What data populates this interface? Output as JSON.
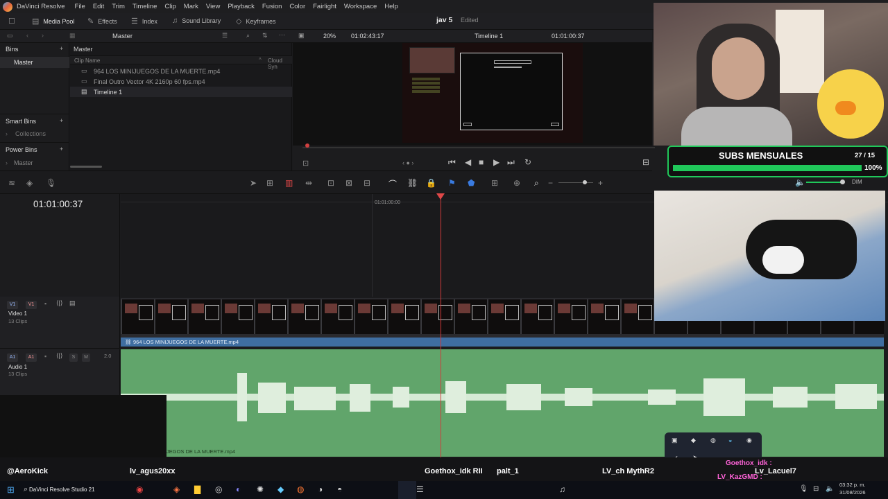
{
  "app": {
    "title": "DaVinci Resolve",
    "menu": [
      "File",
      "Edit",
      "Trim",
      "Timeline",
      "Clip",
      "Mark",
      "View",
      "Playback",
      "Fusion",
      "Color",
      "Fairlight",
      "Workspace",
      "Help"
    ]
  },
  "toolbar": {
    "media_pool": "Media Pool",
    "effects": "Effects",
    "index": "Index",
    "sound_library": "Sound Library",
    "keyframes": "Keyframes",
    "project_name": "jav 5",
    "project_status": "Edited"
  },
  "subbar": {
    "bin_name": "Master",
    "zoom": "20%",
    "source_timecode": "01:02:43:17",
    "timeline_name": "Timeline 1",
    "timeline_timecode": "01:01:00:37"
  },
  "bins": {
    "header": "Bins",
    "master": "Master",
    "smart_bins": "Smart Bins",
    "collections": "Collections",
    "power_bins": "Power Bins",
    "power_master": "Master"
  },
  "clips": {
    "breadcrumb": "Master",
    "col_name": "Clip Name",
    "col_cloud": "Cloud Syn",
    "items": [
      {
        "name": "964 LOS MINIJUEGOS DE LA MUERTE.mp4",
        "icon": "video-clip-icon"
      },
      {
        "name": "Final Outro Vector 4K 2160p 60 fps.mp4",
        "icon": "video-clip-icon"
      },
      {
        "name": "Timeline 1",
        "icon": "timeline-icon"
      }
    ]
  },
  "timeline": {
    "timecode": "01:01:00:37",
    "ruler_label": "01:01:00:00",
    "v1": {
      "badge_a": "V1",
      "badge_b": "V1",
      "name": "Video 1",
      "clips": "13 Clips",
      "clip_label": "964 LOS MINIJUEGOS DE LA MUERTE.mp4"
    },
    "a1": {
      "badge_a": "A1",
      "badge_b": "A1",
      "s": "S",
      "m": "M",
      "level": "2.0",
      "name": "Audio 1",
      "clips": "13 Clips",
      "clip_label": "JEGOS DE LA MUERTE.mp4"
    },
    "volume_label": "DIM"
  },
  "overlay": {
    "subs_title": "SUBS MENSUALES",
    "subs_count": "27 / 15",
    "subs_percent": "100%",
    "subs_progress": 1.0
  },
  "stream_bar": {
    "names": [
      "@AeroKick",
      "lv_agus20xx",
      "Goethox_idk RII",
      "palt_1",
      "LV_ch MythR2",
      "Goethox_idk :",
      "LV_KazGMD :",
      "Lv_Lacuel7",
      "palt_1"
    ]
  },
  "taskbar": {
    "active_app": "DaVinci Resolve Studio 21",
    "time": "03:32 p. m.",
    "date": "31/08/2026"
  },
  "colors": {
    "video_clip": "#3f6ea1",
    "audio_clip": "#61a56b",
    "playhead": "#d03a3a",
    "subs_accent": "#20c85a"
  }
}
